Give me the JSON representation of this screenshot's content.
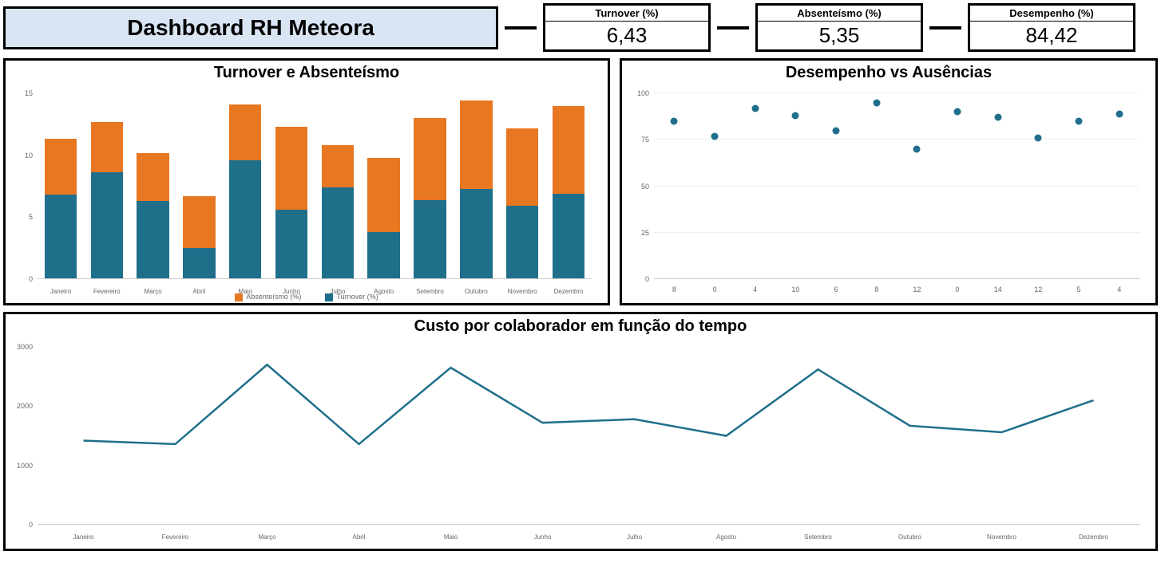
{
  "header": {
    "title": "Dashboard RH Meteora",
    "kpis": [
      {
        "label": "Turnover (%)",
        "value": "6,43"
      },
      {
        "label": "Absenteísmo (%)",
        "value": "5,35"
      },
      {
        "label": "Desempenho (%)",
        "value": "84,42"
      }
    ]
  },
  "colors": {
    "turnover": "#1f6f8b",
    "absenteismo": "#e87722",
    "line": "#1f6f8b",
    "dot": "#1f6f8b",
    "title_bg": "#d9e5f3"
  },
  "chart_data": [
    {
      "id": "turnover_absenteismo",
      "type": "bar",
      "stacked": true,
      "title": "Turnover e Absenteísmo",
      "categories": [
        "Janeiro",
        "Fevereiro",
        "Março",
        "Abril",
        "Maio",
        "Junho",
        "Julho",
        "Agosto",
        "Setembro",
        "Outubro",
        "Novembro",
        "Dezembro"
      ],
      "series": [
        {
          "name": "Turnover (%)",
          "values": [
            6.8,
            8.6,
            6.3,
            2.5,
            9.6,
            5.6,
            7.4,
            3.8,
            6.4,
            7.3,
            5.9,
            6.9
          ]
        },
        {
          "name": "Absenteísmo (%)",
          "values": [
            4.5,
            4.1,
            3.9,
            4.2,
            4.5,
            6.7,
            3.4,
            6.0,
            6.6,
            7.1,
            6.3,
            7.1
          ]
        }
      ],
      "ylim": [
        0,
        15
      ],
      "yticks": [
        0,
        5,
        10,
        15
      ],
      "legend": [
        "Absenteísmo (%)",
        "Turnover (%)"
      ]
    },
    {
      "id": "desempenho_vs_ausencias",
      "type": "scatter",
      "title": "Desempenho vs Ausências",
      "x": [
        8,
        0,
        4,
        10,
        6,
        8,
        12,
        0,
        14,
        12,
        5,
        4
      ],
      "y": [
        85,
        77,
        92,
        88,
        80,
        95,
        70,
        90,
        87,
        76,
        85,
        89
      ],
      "x_tick_labels": [
        "8",
        "0",
        "4",
        "10",
        "6",
        "8",
        "12",
        "0",
        "14",
        "12",
        "5",
        "4"
      ],
      "ylim": [
        0,
        100
      ],
      "yticks": [
        0,
        25,
        50,
        75,
        100
      ]
    },
    {
      "id": "custo_por_colaborador",
      "type": "line",
      "title": "Custo por colaborador em função do tempo",
      "categories": [
        "Janeiro",
        "Fevereiro",
        "Março",
        "Abril",
        "Maio",
        "Junho",
        "Julho",
        "Agosto",
        "Setembro",
        "Outubro",
        "Novembro",
        "Dezembro"
      ],
      "values": [
        1420,
        1360,
        2700,
        1360,
        2650,
        1720,
        1780,
        1500,
        2620,
        1670,
        1560,
        2100
      ],
      "ylim": [
        0,
        3000
      ],
      "yticks": [
        0,
        1000,
        2000,
        3000
      ]
    }
  ]
}
